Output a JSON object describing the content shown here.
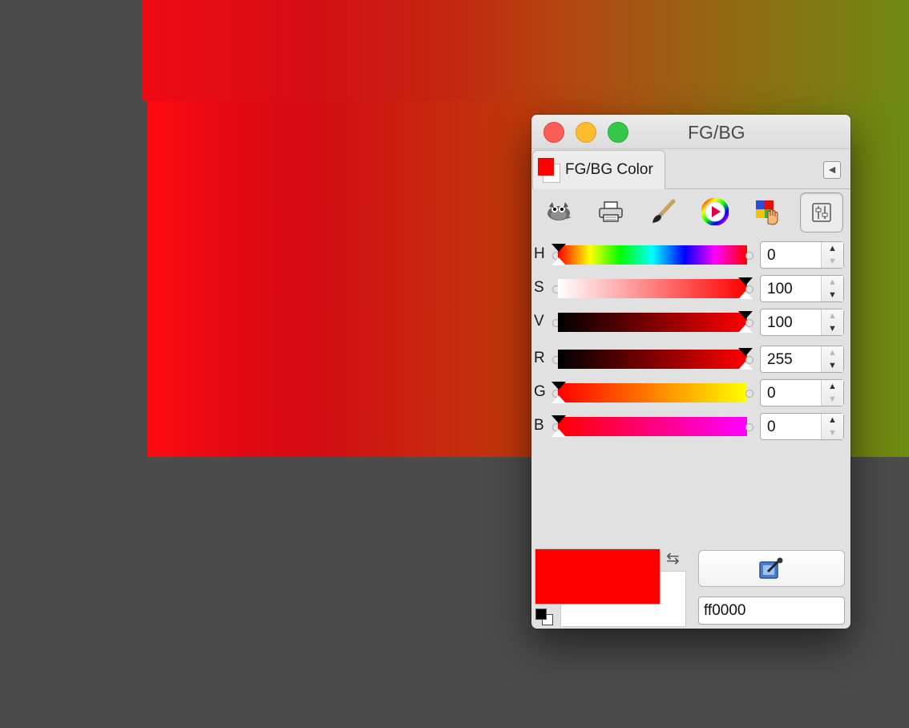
{
  "window": {
    "title": "FG/BG"
  },
  "tab": {
    "label": "FG/BG Color"
  },
  "selectors": [
    {
      "icon": "gimp-wilber-icon"
    },
    {
      "icon": "printer-cmyk-icon"
    },
    {
      "icon": "paintbrush-watercolor-icon"
    },
    {
      "icon": "color-wheel-icon"
    },
    {
      "icon": "palette-hand-icon"
    },
    {
      "icon": "scales-sliders-icon"
    }
  ],
  "sliders": [
    {
      "label": "H",
      "value": "0"
    },
    {
      "label": "S",
      "value": "100"
    },
    {
      "label": "V",
      "value": "100"
    },
    {
      "label": "R",
      "value": "255"
    },
    {
      "label": "G",
      "value": "0"
    },
    {
      "label": "B",
      "value": "0"
    }
  ],
  "fg_color": "#ff0000",
  "bg_color": "#ffffff",
  "hex": {
    "value": "ff0000"
  }
}
